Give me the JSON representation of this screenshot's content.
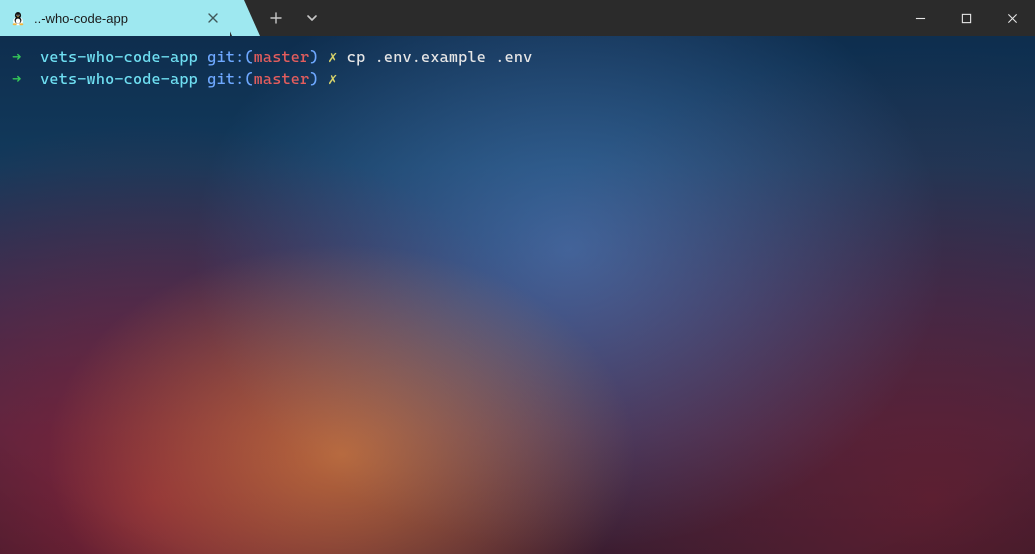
{
  "window": {
    "tab_title": "..-who-code-app",
    "tab_icon": "tux-icon",
    "new_tab_label": "+",
    "tab_dropdown_label": "v"
  },
  "terminal": {
    "lines": [
      {
        "arrow": "➜",
        "cwd": "vets-who-code-app",
        "git_prefix": "git:(",
        "branch": "master",
        "git_suffix": ")",
        "dirty": "✗",
        "command": "cp .env.example .env"
      },
      {
        "arrow": "➜",
        "cwd": "vets-who-code-app",
        "git_prefix": "git:(",
        "branch": "master",
        "git_suffix": ")",
        "dirty": "✗",
        "command": ""
      }
    ]
  },
  "win_controls": {
    "minimize": "minimize",
    "maximize": "maximize",
    "close": "close"
  }
}
